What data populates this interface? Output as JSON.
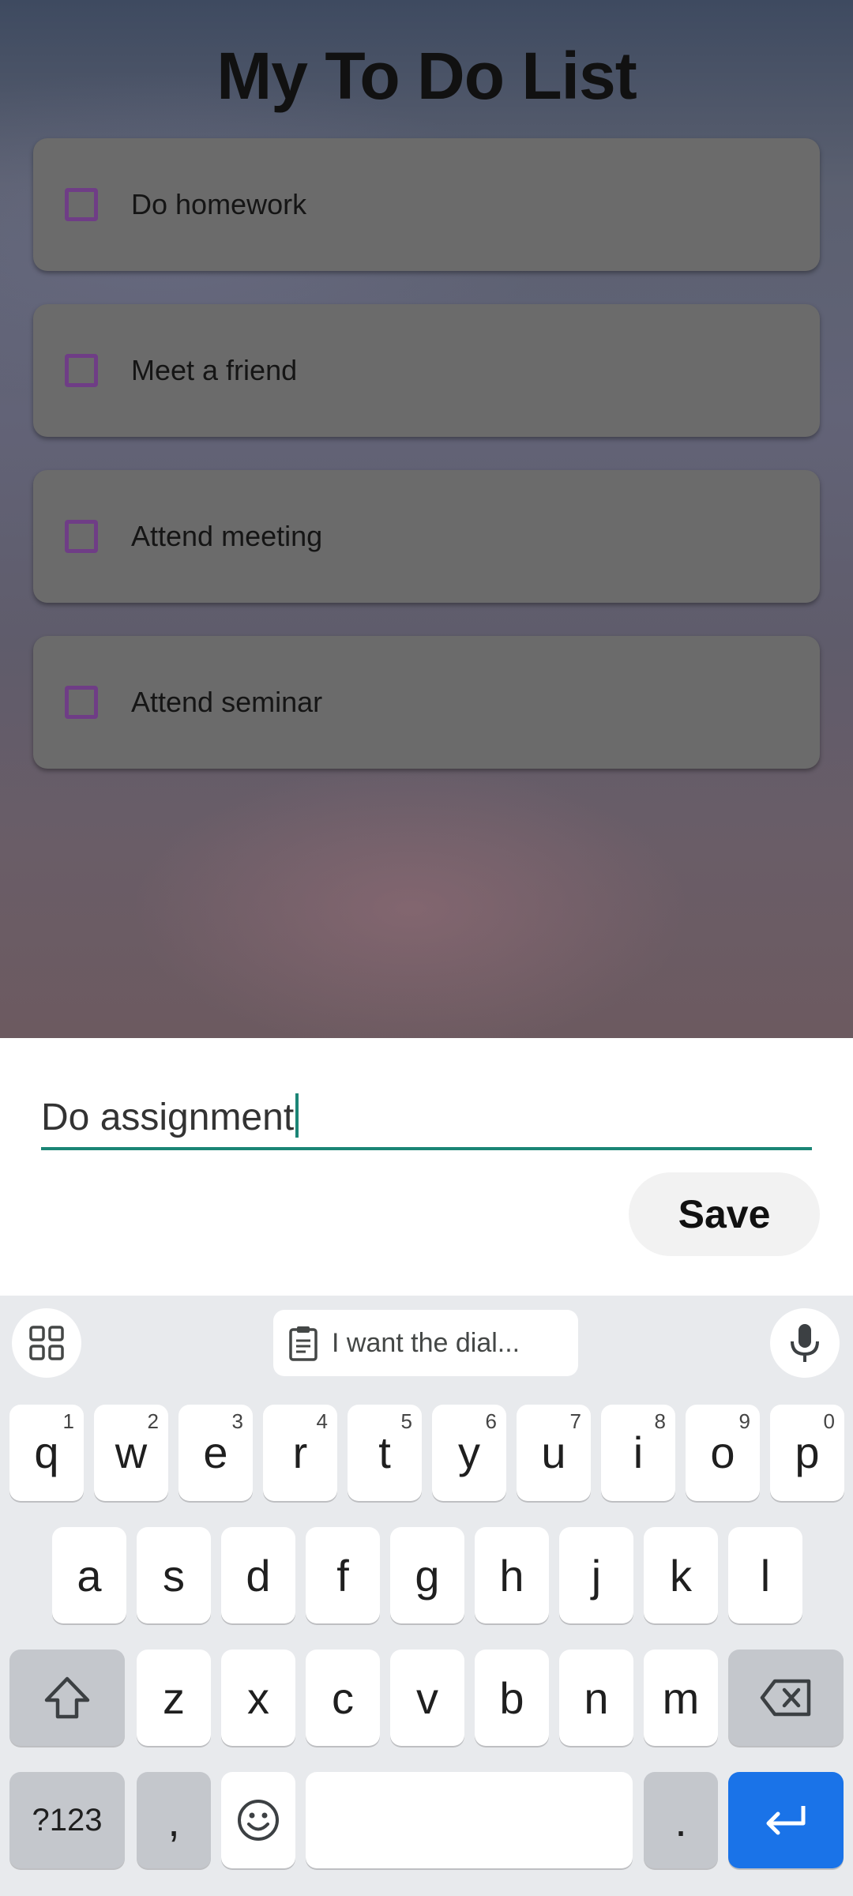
{
  "app": {
    "title": "My To Do List",
    "tasks": [
      {
        "label": "Do homework",
        "checked": false
      },
      {
        "label": "Meet a friend",
        "checked": false
      },
      {
        "label": "Attend meeting",
        "checked": false
      },
      {
        "label": "Attend seminar",
        "checked": false
      }
    ]
  },
  "sheet": {
    "input_value": "Do assignment",
    "save_label": "Save",
    "accent_color": "#1b8576"
  },
  "keyboard": {
    "clipboard_text": "I want the dial...",
    "row1": [
      {
        "key": "q",
        "hint": "1"
      },
      {
        "key": "w",
        "hint": "2"
      },
      {
        "key": "e",
        "hint": "3"
      },
      {
        "key": "r",
        "hint": "4"
      },
      {
        "key": "t",
        "hint": "5"
      },
      {
        "key": "y",
        "hint": "6"
      },
      {
        "key": "u",
        "hint": "7"
      },
      {
        "key": "i",
        "hint": "8"
      },
      {
        "key": "o",
        "hint": "9"
      },
      {
        "key": "p",
        "hint": "0"
      }
    ],
    "row2": [
      "a",
      "s",
      "d",
      "f",
      "g",
      "h",
      "j",
      "k",
      "l"
    ],
    "row3": [
      "z",
      "x",
      "c",
      "v",
      "b",
      "n",
      "m"
    ],
    "symbols_label": "?123",
    "comma_label": ",",
    "period_label": ".",
    "enter_color": "#1a73e8"
  }
}
